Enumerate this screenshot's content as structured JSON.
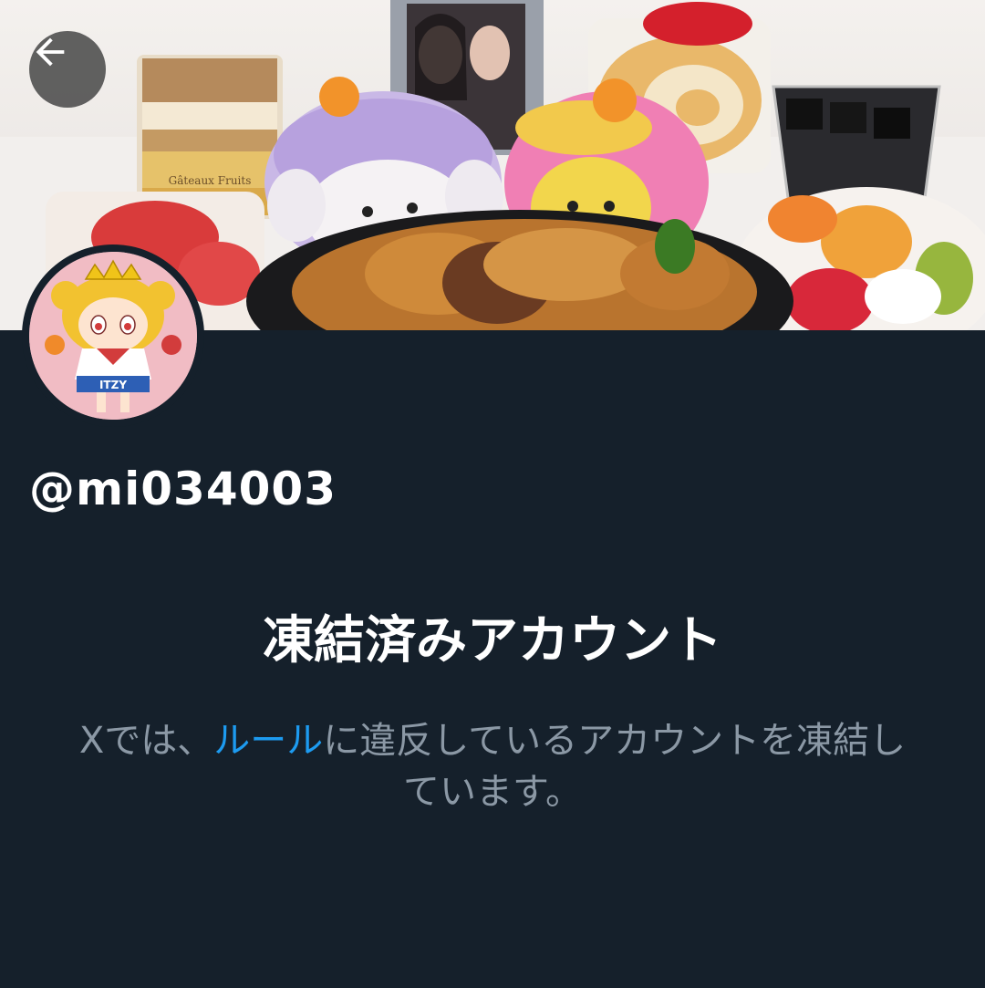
{
  "profile": {
    "handle": "@mi034003"
  },
  "suspended": {
    "title": "凍結済みアカウント",
    "desc_prefix": "Xでは、",
    "rules_link": "ルール",
    "desc_suffix": "に違反しているアカウントを凍結しています。"
  },
  "banner": {
    "cake_box_text": "Gâteaux Fruits",
    "avatar_text": "ITZY"
  },
  "colors": {
    "background": "#15202b",
    "text_primary": "#ffffff",
    "text_secondary": "#8b98a5",
    "link": "#1d9bf0"
  },
  "icons": {
    "back": "arrow-left-icon"
  }
}
